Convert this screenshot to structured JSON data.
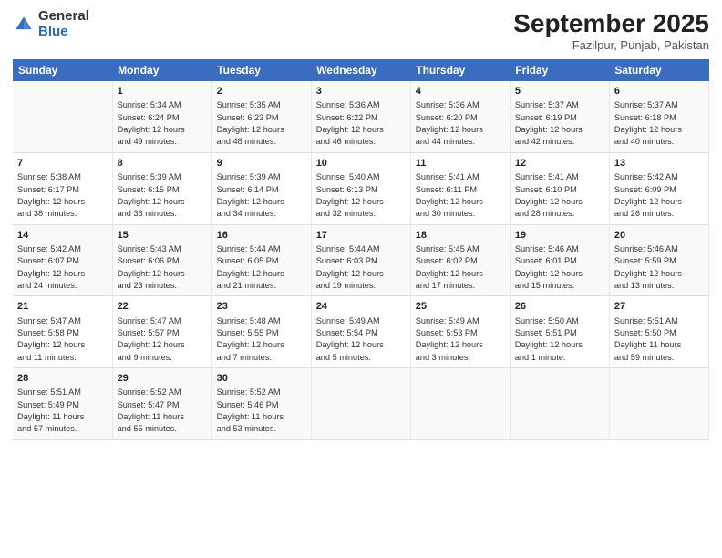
{
  "header": {
    "logo_general": "General",
    "logo_blue": "Blue",
    "month_title": "September 2025",
    "location": "Fazilpur, Punjab, Pakistan"
  },
  "weekdays": [
    "Sunday",
    "Monday",
    "Tuesday",
    "Wednesday",
    "Thursday",
    "Friday",
    "Saturday"
  ],
  "weeks": [
    [
      {
        "day": "",
        "info": ""
      },
      {
        "day": "1",
        "info": "Sunrise: 5:34 AM\nSunset: 6:24 PM\nDaylight: 12 hours\nand 49 minutes."
      },
      {
        "day": "2",
        "info": "Sunrise: 5:35 AM\nSunset: 6:23 PM\nDaylight: 12 hours\nand 48 minutes."
      },
      {
        "day": "3",
        "info": "Sunrise: 5:36 AM\nSunset: 6:22 PM\nDaylight: 12 hours\nand 46 minutes."
      },
      {
        "day": "4",
        "info": "Sunrise: 5:36 AM\nSunset: 6:20 PM\nDaylight: 12 hours\nand 44 minutes."
      },
      {
        "day": "5",
        "info": "Sunrise: 5:37 AM\nSunset: 6:19 PM\nDaylight: 12 hours\nand 42 minutes."
      },
      {
        "day": "6",
        "info": "Sunrise: 5:37 AM\nSunset: 6:18 PM\nDaylight: 12 hours\nand 40 minutes."
      }
    ],
    [
      {
        "day": "7",
        "info": "Sunrise: 5:38 AM\nSunset: 6:17 PM\nDaylight: 12 hours\nand 38 minutes."
      },
      {
        "day": "8",
        "info": "Sunrise: 5:39 AM\nSunset: 6:15 PM\nDaylight: 12 hours\nand 36 minutes."
      },
      {
        "day": "9",
        "info": "Sunrise: 5:39 AM\nSunset: 6:14 PM\nDaylight: 12 hours\nand 34 minutes."
      },
      {
        "day": "10",
        "info": "Sunrise: 5:40 AM\nSunset: 6:13 PM\nDaylight: 12 hours\nand 32 minutes."
      },
      {
        "day": "11",
        "info": "Sunrise: 5:41 AM\nSunset: 6:11 PM\nDaylight: 12 hours\nand 30 minutes."
      },
      {
        "day": "12",
        "info": "Sunrise: 5:41 AM\nSunset: 6:10 PM\nDaylight: 12 hours\nand 28 minutes."
      },
      {
        "day": "13",
        "info": "Sunrise: 5:42 AM\nSunset: 6:09 PM\nDaylight: 12 hours\nand 26 minutes."
      }
    ],
    [
      {
        "day": "14",
        "info": "Sunrise: 5:42 AM\nSunset: 6:07 PM\nDaylight: 12 hours\nand 24 minutes."
      },
      {
        "day": "15",
        "info": "Sunrise: 5:43 AM\nSunset: 6:06 PM\nDaylight: 12 hours\nand 23 minutes."
      },
      {
        "day": "16",
        "info": "Sunrise: 5:44 AM\nSunset: 6:05 PM\nDaylight: 12 hours\nand 21 minutes."
      },
      {
        "day": "17",
        "info": "Sunrise: 5:44 AM\nSunset: 6:03 PM\nDaylight: 12 hours\nand 19 minutes."
      },
      {
        "day": "18",
        "info": "Sunrise: 5:45 AM\nSunset: 6:02 PM\nDaylight: 12 hours\nand 17 minutes."
      },
      {
        "day": "19",
        "info": "Sunrise: 5:46 AM\nSunset: 6:01 PM\nDaylight: 12 hours\nand 15 minutes."
      },
      {
        "day": "20",
        "info": "Sunrise: 5:46 AM\nSunset: 5:59 PM\nDaylight: 12 hours\nand 13 minutes."
      }
    ],
    [
      {
        "day": "21",
        "info": "Sunrise: 5:47 AM\nSunset: 5:58 PM\nDaylight: 12 hours\nand 11 minutes."
      },
      {
        "day": "22",
        "info": "Sunrise: 5:47 AM\nSunset: 5:57 PM\nDaylight: 12 hours\nand 9 minutes."
      },
      {
        "day": "23",
        "info": "Sunrise: 5:48 AM\nSunset: 5:55 PM\nDaylight: 12 hours\nand 7 minutes."
      },
      {
        "day": "24",
        "info": "Sunrise: 5:49 AM\nSunset: 5:54 PM\nDaylight: 12 hours\nand 5 minutes."
      },
      {
        "day": "25",
        "info": "Sunrise: 5:49 AM\nSunset: 5:53 PM\nDaylight: 12 hours\nand 3 minutes."
      },
      {
        "day": "26",
        "info": "Sunrise: 5:50 AM\nSunset: 5:51 PM\nDaylight: 12 hours\nand 1 minute."
      },
      {
        "day": "27",
        "info": "Sunrise: 5:51 AM\nSunset: 5:50 PM\nDaylight: 11 hours\nand 59 minutes."
      }
    ],
    [
      {
        "day": "28",
        "info": "Sunrise: 5:51 AM\nSunset: 5:49 PM\nDaylight: 11 hours\nand 57 minutes."
      },
      {
        "day": "29",
        "info": "Sunrise: 5:52 AM\nSunset: 5:47 PM\nDaylight: 11 hours\nand 55 minutes."
      },
      {
        "day": "30",
        "info": "Sunrise: 5:52 AM\nSunset: 5:46 PM\nDaylight: 11 hours\nand 53 minutes."
      },
      {
        "day": "",
        "info": ""
      },
      {
        "day": "",
        "info": ""
      },
      {
        "day": "",
        "info": ""
      },
      {
        "day": "",
        "info": ""
      }
    ]
  ]
}
